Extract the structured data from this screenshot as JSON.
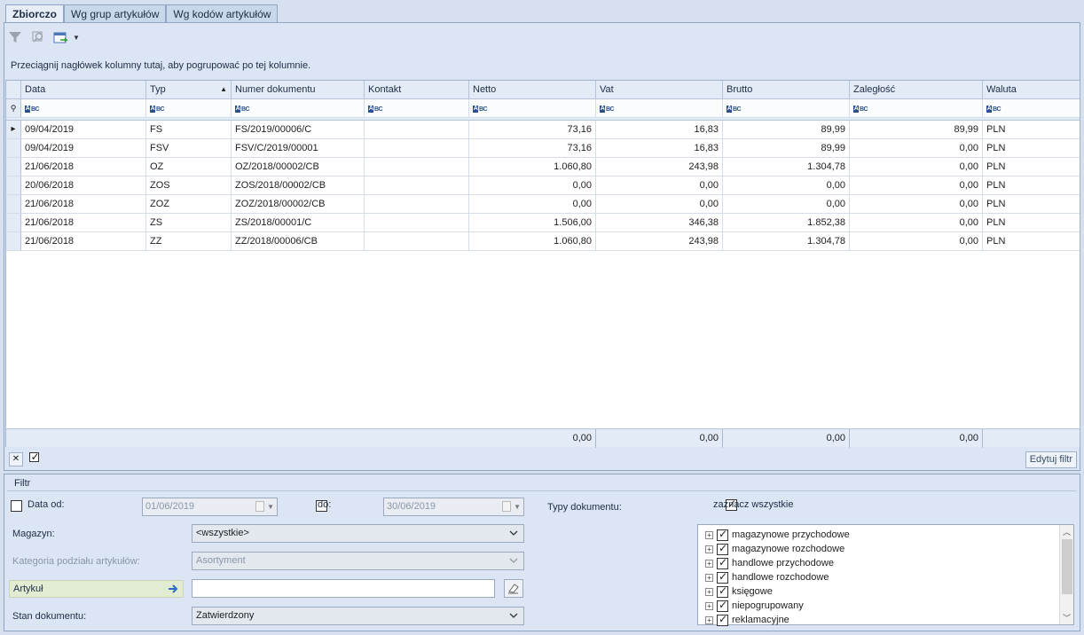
{
  "tabs": [
    "Zbiorczo",
    "Wg grup artykułów",
    "Wg kodów artykułów"
  ],
  "group_hint": "Przeciągnij nagłówek kolumny tutaj, aby pogrupować po tej kolumnie.",
  "columns": [
    "Data",
    "Typ",
    "Numer dokumentu",
    "Kontakt",
    "Netto",
    "Vat",
    "Brutto",
    "Zaległość",
    "Waluta"
  ],
  "rows": [
    {
      "data": "09/04/2019",
      "typ": "FS",
      "numer": "FS/2019/00006/C",
      "kontakt": "",
      "netto": "73,16",
      "vat": "16,83",
      "brutto": "89,99",
      "zaleglosc": "89,99",
      "waluta": "PLN"
    },
    {
      "data": "09/04/2019",
      "typ": "FSV",
      "numer": "FSV/C/2019/00001",
      "kontakt": "",
      "netto": "73,16",
      "vat": "16,83",
      "brutto": "89,99",
      "zaleglosc": "0,00",
      "waluta": "PLN"
    },
    {
      "data": "21/06/2018",
      "typ": "OZ",
      "numer": "OZ/2018/00002/CB",
      "kontakt": "",
      "netto": "1.060,80",
      "vat": "243,98",
      "brutto": "1.304,78",
      "zaleglosc": "0,00",
      "waluta": "PLN"
    },
    {
      "data": "20/06/2018",
      "typ": "ZOS",
      "numer": "ZOS/2018/00002/CB",
      "kontakt": "",
      "netto": "0,00",
      "vat": "0,00",
      "brutto": "0,00",
      "zaleglosc": "0,00",
      "waluta": "PLN"
    },
    {
      "data": "21/06/2018",
      "typ": "ZOZ",
      "numer": "ZOZ/2018/00002/CB",
      "kontakt": "",
      "netto": "0,00",
      "vat": "0,00",
      "brutto": "0,00",
      "zaleglosc": "0,00",
      "waluta": "PLN"
    },
    {
      "data": "21/06/2018",
      "typ": "ZS",
      "numer": "ZS/2018/00001/C",
      "kontakt": "",
      "netto": "1.506,00",
      "vat": "346,38",
      "brutto": "1.852,38",
      "zaleglosc": "0,00",
      "waluta": "PLN"
    },
    {
      "data": "21/06/2018",
      "typ": "ZZ",
      "numer": "ZZ/2018/00006/CB",
      "kontakt": "",
      "netto": "1.060,80",
      "vat": "243,98",
      "brutto": "1.304,78",
      "zaleglosc": "0,00",
      "waluta": "PLN"
    }
  ],
  "totals": {
    "netto": "0,00",
    "vat": "0,00",
    "brutto": "0,00",
    "zaleglosc": "0,00"
  },
  "edit_filter_label": "Edytuj filtr",
  "filter": {
    "title": "Filtr",
    "date_from_label": "Data od:",
    "date_from_value": "01/06/2019",
    "date_to_label": "do:",
    "date_to_value": "30/06/2019",
    "doc_types_label": "Typy dokumentu:",
    "select_all_label": "zaznacz wszystkie",
    "magazyn_label": "Magazyn:",
    "magazyn_value": "<wszystkie>",
    "kategoria_label": "Kategoria podziału artykułów:",
    "kategoria_value": "Asortyment",
    "artykul_label": "Artykuł",
    "artykul_value": "",
    "stan_label": "Stan dokumentu:",
    "stan_value": "Zatwierdzony",
    "doc_types": [
      "magazynowe przychodowe",
      "magazynowe rozchodowe",
      "handlowe przychodowe",
      "handlowe rozchodowe",
      "księgowe",
      "niepogrupowany",
      "reklamacyjne"
    ]
  }
}
